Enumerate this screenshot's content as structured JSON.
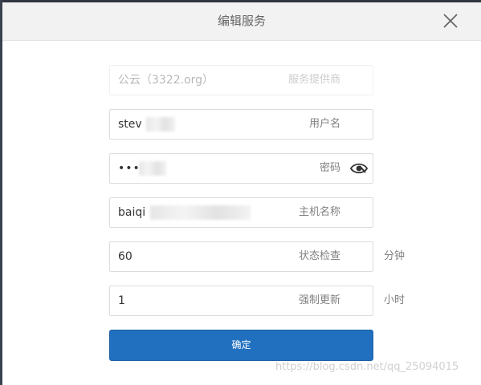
{
  "dialog": {
    "title": "编辑服务",
    "close_icon": "close-icon"
  },
  "form": {
    "provider": {
      "value": "公云（3322.org）",
      "label": "服务提供商"
    },
    "username": {
      "value": "stev",
      "label": "用户名"
    },
    "password": {
      "value": "••••",
      "label": "密码",
      "icon": "eye-icon"
    },
    "hostname": {
      "value": "baiqi",
      "label": "主机名称"
    },
    "status_check": {
      "value": "60",
      "label": "状态检查",
      "unit": "分钟"
    },
    "force_update": {
      "value": "1",
      "label": "强制更新",
      "unit": "小时"
    }
  },
  "confirm_label": "确定",
  "watermark": "https://blog.csdn.net/qq_25094015",
  "colors": {
    "primary": "#2170c0",
    "header_bg": "#f2f2f2"
  }
}
